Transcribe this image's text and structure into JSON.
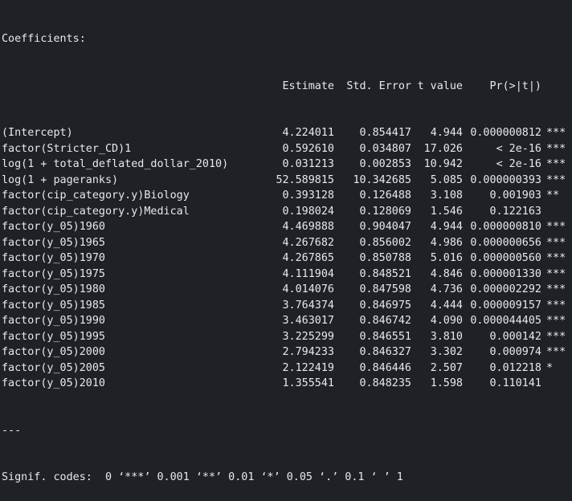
{
  "console": {
    "title": "Coefficients:",
    "headers": {
      "estimate": "Estimate",
      "std_error": "Std. Error",
      "t_value": "t value",
      "p_value": "Pr(>|t|)"
    },
    "rows": [
      {
        "name": "(Intercept)",
        "estimate": "4.224011",
        "std_error": "0.854417",
        "t_value": "4.944",
        "p_value": "0.000000812",
        "sig": "***"
      },
      {
        "name": "factor(Stricter_CD)1",
        "estimate": "0.592610",
        "std_error": "0.034807",
        "t_value": "17.026",
        "p_value": "< 2e-16",
        "sig": "***"
      },
      {
        "name": "log(1 + total_deflated_dollar_2010)",
        "estimate": "0.031213",
        "std_error": "0.002853",
        "t_value": "10.942",
        "p_value": "< 2e-16",
        "sig": "***"
      },
      {
        "name": "log(1 + pageranks)",
        "estimate": "52.589815",
        "std_error": "10.342685",
        "t_value": "5.085",
        "p_value": "0.000000393",
        "sig": "***"
      },
      {
        "name": "factor(cip_category.y)Biology",
        "estimate": "0.393128",
        "std_error": "0.126488",
        "t_value": "3.108",
        "p_value": "0.001903",
        "sig": "**"
      },
      {
        "name": "factor(cip_category.y)Medical",
        "estimate": "0.198024",
        "std_error": "0.128069",
        "t_value": "1.546",
        "p_value": "0.122163",
        "sig": ""
      },
      {
        "name": "factor(y_05)1960",
        "estimate": "4.469888",
        "std_error": "0.904047",
        "t_value": "4.944",
        "p_value": "0.000000810",
        "sig": "***"
      },
      {
        "name": "factor(y_05)1965",
        "estimate": "4.267682",
        "std_error": "0.856002",
        "t_value": "4.986",
        "p_value": "0.000000656",
        "sig": "***"
      },
      {
        "name": "factor(y_05)1970",
        "estimate": "4.267865",
        "std_error": "0.850788",
        "t_value": "5.016",
        "p_value": "0.000000560",
        "sig": "***"
      },
      {
        "name": "factor(y_05)1975",
        "estimate": "4.111904",
        "std_error": "0.848521",
        "t_value": "4.846",
        "p_value": "0.000001330",
        "sig": "***"
      },
      {
        "name": "factor(y_05)1980",
        "estimate": "4.014076",
        "std_error": "0.847598",
        "t_value": "4.736",
        "p_value": "0.000002292",
        "sig": "***"
      },
      {
        "name": "factor(y_05)1985",
        "estimate": "3.764374",
        "std_error": "0.846975",
        "t_value": "4.444",
        "p_value": "0.000009157",
        "sig": "***"
      },
      {
        "name": "factor(y_05)1990",
        "estimate": "3.463017",
        "std_error": "0.846742",
        "t_value": "4.090",
        "p_value": "0.000044405",
        "sig": "***"
      },
      {
        "name": "factor(y_05)1995",
        "estimate": "3.225299",
        "std_error": "0.846551",
        "t_value": "3.810",
        "p_value": "0.000142",
        "sig": "***"
      },
      {
        "name": "factor(y_05)2000",
        "estimate": "2.794233",
        "std_error": "0.846327",
        "t_value": "3.302",
        "p_value": "0.000974",
        "sig": "***"
      },
      {
        "name": "factor(y_05)2005",
        "estimate": "2.122419",
        "std_error": "0.846446",
        "t_value": "2.507",
        "p_value": "0.012218",
        "sig": "*"
      },
      {
        "name": "factor(y_05)2010",
        "estimate": "1.355541",
        "std_error": "0.848235",
        "t_value": "1.598",
        "p_value": "0.110141",
        "sig": ""
      }
    ],
    "separator": "---",
    "signif": "Signif. codes:  0 ‘***’ 0.001 ‘**’ 0.01 ‘*’ 0.05 ‘.’ 0.1 ‘ ’ 1"
  }
}
